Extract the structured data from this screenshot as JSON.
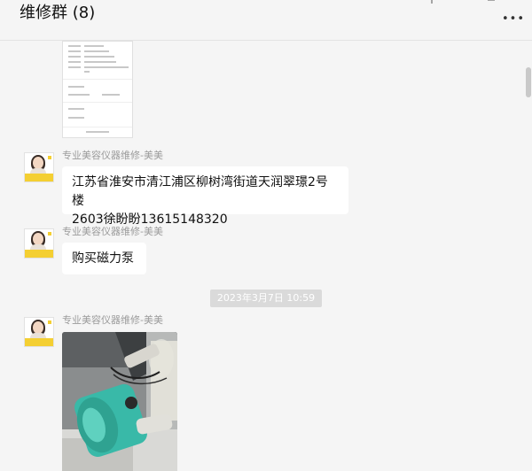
{
  "header": {
    "title": "维修群 (8)"
  },
  "messages": [
    {
      "type": "image",
      "description": "screenshot"
    },
    {
      "sender": "专业美容仪器维修-美美",
      "text_line1": "江苏省淮安市清江浦区柳树湾街道天润翠璟2号楼",
      "text_line2": "2603徐盼盼13615148320"
    },
    {
      "sender": "专业美容仪器维修-美美",
      "text": "购买磁力泵"
    },
    {
      "timestamp": "2023年3月7日 10:59"
    },
    {
      "sender": "专业美容仪器维修-美美",
      "type": "image"
    }
  ],
  "colors": {
    "background": "#f5f5f5",
    "bubble": "#ffffff",
    "pump": "#39b9a8",
    "avatar_accent": "#f4cf32"
  }
}
